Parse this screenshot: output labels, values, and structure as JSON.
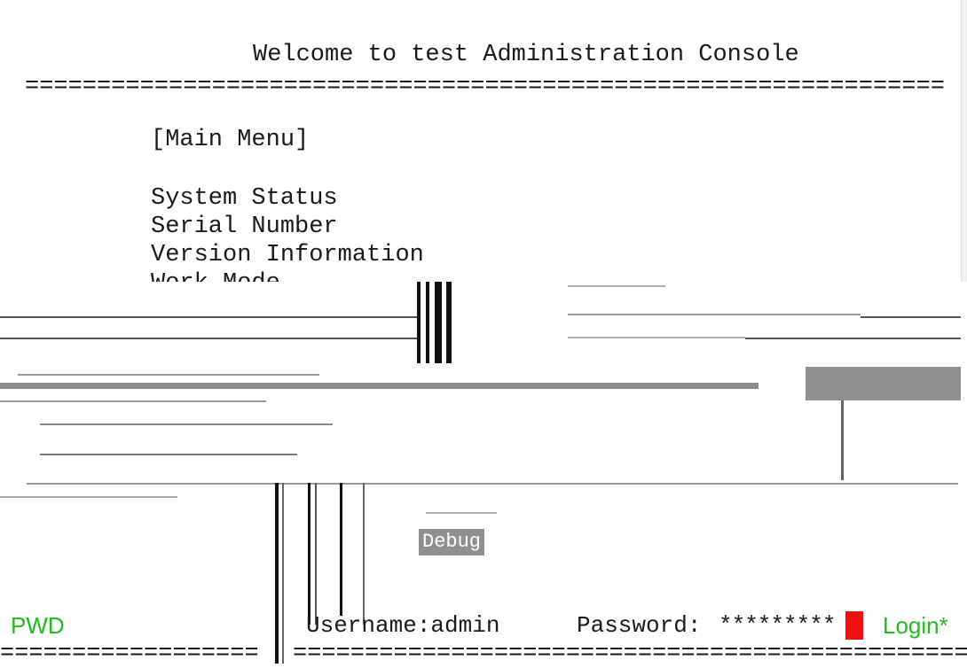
{
  "header": {
    "title": "Welcome to test Administration Console",
    "rule": "================================================================"
  },
  "menu": {
    "heading": "[Main Menu]",
    "items": [
      {
        "label": "System Status"
      },
      {
        "label": "Serial Number"
      },
      {
        "label": "Version Information"
      },
      {
        "label": "Work Mode"
      }
    ],
    "selected_label": "Debug"
  },
  "status_bar": {
    "pwd_key": "PWD",
    "username_text": "Username:admin",
    "password_label": "Password:",
    "password_value": "*********",
    "login_key": "Login*",
    "cursor_color": "#ee1111",
    "key_color": "#22bb22",
    "rule_left": "==================",
    "rule_right": "================================================"
  }
}
